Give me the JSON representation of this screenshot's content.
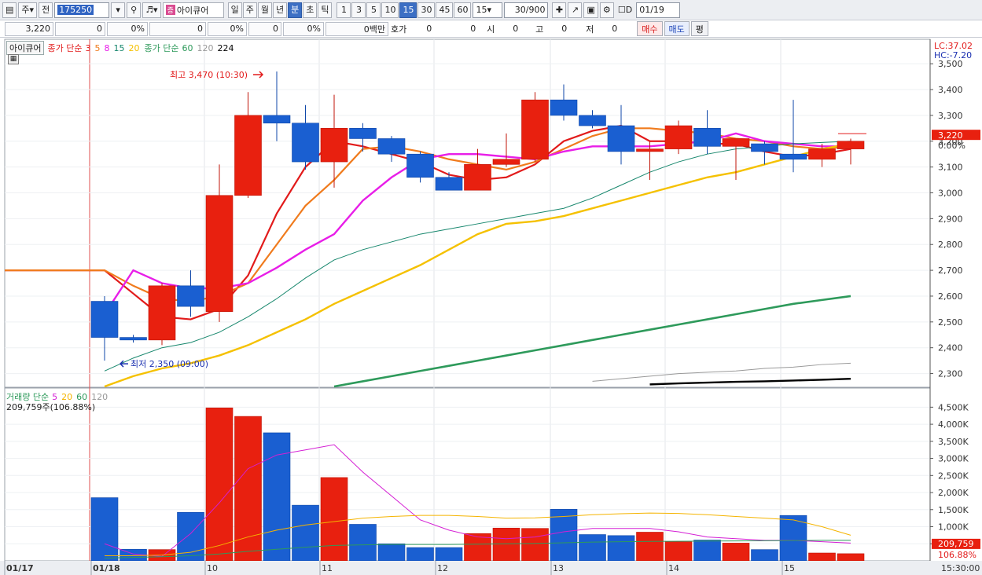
{
  "toolbar": {
    "market_label": "주",
    "prev_label": "전",
    "code": "175250",
    "stock_name": "아이큐어",
    "stock_mark": "증",
    "period_buttons": [
      "일",
      "주",
      "월",
      "년",
      "분",
      "초",
      "틱"
    ],
    "selected_period": "분",
    "interval_buttons": [
      "1",
      "3",
      "5",
      "10",
      "15",
      "30",
      "45",
      "60"
    ],
    "selected_interval": "15",
    "interval_value": "15",
    "count_value": "30/900",
    "date_value": "01/19",
    "checkbox_label": "D"
  },
  "infobar": {
    "price": "3,220",
    "change": "0",
    "rate1": "0%",
    "volume": "0",
    "rate2": "0%",
    "v3": "0",
    "rate3": "0%",
    "mil_label": "0백만",
    "quote_label": "호가",
    "q1": "0",
    "q2": "0",
    "open_label": "시",
    "open_value": "0",
    "high_label": "고",
    "high_value": "0",
    "low_label": "저",
    "low_value": "0",
    "buy_label": "매수",
    "sell_label": "매도",
    "flat_label": "평"
  },
  "price_legend": {
    "name": "아이큐어",
    "ma_label": "종가 단순",
    "ma_periods": [
      "3",
      "5",
      "8",
      "15",
      "20"
    ],
    "ma_colors": [
      "#e21b1b",
      "#f07b1d",
      "#e81ee8",
      "#17876d",
      "#f5c100"
    ],
    "ma2_label": "종가 단순",
    "ma2_periods": [
      "60",
      "120",
      "224"
    ],
    "ma2_colors": [
      "#2e9a5b",
      "#999999",
      "#000000"
    ]
  },
  "volume_legend": {
    "label": "거래량 단순",
    "periods": [
      "5",
      "20",
      "60",
      "120"
    ],
    "period_colors": [
      "#d41fd4",
      "#f5b400",
      "#2e9a5b",
      "#999999"
    ],
    "summary": "209,759주(106.88%)"
  },
  "right_labels": {
    "lc": "LC:37.02",
    "hc": "HC:-7.20",
    "current_price": "3,220",
    "current_rate": "0.00%",
    "current_volume": "209,759",
    "volume_rate": "106.88%",
    "time": "15:30:00"
  },
  "annotations": {
    "high": "최고 3,470 (10:30)",
    "low": "최저 2,350 (09:00)"
  },
  "x_axis_labels": [
    "01/17",
    "01/18",
    "10",
    "11",
    "12",
    "13",
    "14",
    "15"
  ],
  "chart_data": {
    "type": "candlestick",
    "price_axis": {
      "ticks": [
        "3,500",
        "3,400",
        "3,300",
        "3,200",
        "3,100",
        "3,000",
        "2,900",
        "2,800",
        "2,700",
        "2,600",
        "2,500",
        "2,400",
        "2,300"
      ],
      "ylim": [
        2250,
        3540
      ]
    },
    "volume_axis": {
      "ticks": [
        "4,500K",
        "4,000K",
        "3,500K",
        "3,000K",
        "2,500K",
        "2,000K",
        "1,500K",
        "1,000K",
        "500K"
      ],
      "ylim": [
        0,
        4600
      ]
    },
    "candles": [
      {
        "o": 2580,
        "h": 2600,
        "l": 2350,
        "c": 2440,
        "v": 1850
      },
      {
        "o": 2440,
        "h": 2450,
        "l": 2420,
        "c": 2430,
        "v": 340
      },
      {
        "o": 2430,
        "h": 2650,
        "l": 2410,
        "c": 2640,
        "v": 330
      },
      {
        "o": 2640,
        "h": 2700,
        "l": 2520,
        "c": 2560,
        "v": 1420
      },
      {
        "o": 2540,
        "h": 3110,
        "l": 2500,
        "c": 2990,
        "v": 4480
      },
      {
        "o": 2990,
        "h": 3390,
        "l": 2980,
        "c": 3300,
        "v": 4230
      },
      {
        "o": 3300,
        "h": 3470,
        "l": 3200,
        "c": 3270,
        "v": 3750
      },
      {
        "o": 3270,
        "h": 3340,
        "l": 3090,
        "c": 3120,
        "v": 1630
      },
      {
        "o": 3120,
        "h": 3380,
        "l": 3020,
        "c": 3250,
        "v": 2440
      },
      {
        "o": 3250,
        "h": 3270,
        "l": 3160,
        "c": 3210,
        "v": 1070
      },
      {
        "o": 3210,
        "h": 3220,
        "l": 3120,
        "c": 3150,
        "v": 500
      },
      {
        "o": 3150,
        "h": 3160,
        "l": 3040,
        "c": 3060,
        "v": 390
      },
      {
        "o": 3060,
        "h": 3080,
        "l": 3010,
        "c": 3010,
        "v": 390
      },
      {
        "o": 3010,
        "h": 3170,
        "l": 3010,
        "c": 3110,
        "v": 800
      },
      {
        "o": 3110,
        "h": 3230,
        "l": 3100,
        "c": 3130,
        "v": 960
      },
      {
        "o": 3130,
        "h": 3390,
        "l": 3120,
        "c": 3360,
        "v": 950
      },
      {
        "o": 3360,
        "h": 3420,
        "l": 3280,
        "c": 3300,
        "v": 1510
      },
      {
        "o": 3300,
        "h": 3320,
        "l": 3250,
        "c": 3260,
        "v": 770
      },
      {
        "o": 3260,
        "h": 3340,
        "l": 3110,
        "c": 3160,
        "v": 740
      },
      {
        "o": 3160,
        "h": 3200,
        "l": 3050,
        "c": 3170,
        "v": 840
      },
      {
        "o": 3170,
        "h": 3280,
        "l": 3150,
        "c": 3260,
        "v": 560
      },
      {
        "o": 3250,
        "h": 3320,
        "l": 3150,
        "c": 3180,
        "v": 610
      },
      {
        "o": 3180,
        "h": 3190,
        "l": 3050,
        "c": 3210,
        "v": 520
      },
      {
        "o": 3190,
        "h": 3200,
        "l": 3110,
        "c": 3160,
        "v": 330
      },
      {
        "o": 3150,
        "h": 3360,
        "l": 3080,
        "c": 3130,
        "v": 1330
      },
      {
        "o": 3130,
        "h": 3190,
        "l": 3100,
        "c": 3170,
        "v": 230
      },
      {
        "o": 3170,
        "h": 3210,
        "l": 3110,
        "c": 3200,
        "v": 210
      }
    ],
    "moving_averages": [
      {
        "name": "3",
        "color": "#e21b1b",
        "values": [
          2700,
          2610,
          2520,
          2510,
          2550,
          2680,
          2920,
          3100,
          3200,
          3180,
          3150,
          3120,
          3070,
          3050,
          3060,
          3110,
          3200,
          3240,
          3260,
          3200,
          3200,
          3190,
          3190,
          3160,
          3140,
          3150,
          3170
        ]
      },
      {
        "name": "5",
        "color": "#f07b1d",
        "values": [
          2700,
          2640,
          2590,
          2580,
          2600,
          2650,
          2800,
          2950,
          3050,
          3170,
          3180,
          3160,
          3130,
          3110,
          3090,
          3120,
          3170,
          3220,
          3250,
          3250,
          3240,
          3230,
          3210,
          3200,
          3180,
          3170,
          3180
        ]
      },
      {
        "name": "8",
        "color": "#e81ee8",
        "values": [
          2530,
          2700,
          2650,
          2630,
          2630,
          2650,
          2710,
          2780,
          2840,
          2970,
          3060,
          3130,
          3150,
          3150,
          3140,
          3130,
          3160,
          3180,
          3180,
          3180,
          3190,
          3200,
          3230,
          3200,
          3190,
          3180,
          3180
        ]
      },
      {
        "name": "15",
        "color": "#17876d",
        "values": [
          2310,
          2360,
          2400,
          2420,
          2460,
          2520,
          2590,
          2670,
          2740,
          2780,
          2810,
          2840,
          2860,
          2880,
          2900,
          2920,
          2940,
          2980,
          3030,
          3080,
          3120,
          3150,
          3170,
          3180,
          3190,
          3195,
          3200
        ]
      },
      {
        "name": "20",
        "color": "#f5c100",
        "values": [
          2250,
          2290,
          2320,
          2340,
          2370,
          2410,
          2460,
          2510,
          2570,
          2620,
          2670,
          2720,
          2780,
          2840,
          2880,
          2890,
          2910,
          2940,
          2970,
          3000,
          3030,
          3060,
          3080,
          3110,
          3140,
          3170,
          3190
        ]
      },
      {
        "name": "60",
        "color": "#2e9a5b",
        "values": [
          null,
          null,
          null,
          null,
          null,
          null,
          null,
          null,
          2250,
          2270,
          2290,
          2310,
          2330,
          2350,
          2370,
          2390,
          2410,
          2430,
          2450,
          2470,
          2490,
          2510,
          2530,
          2550,
          2570,
          2585,
          2600
        ]
      },
      {
        "name": "120",
        "color": "#999999",
        "values": [
          null,
          null,
          null,
          null,
          null,
          null,
          null,
          null,
          null,
          null,
          null,
          null,
          null,
          null,
          null,
          null,
          null,
          2270,
          2280,
          2290,
          2300,
          2305,
          2310,
          2320,
          2325,
          2335,
          2340
        ]
      },
      {
        "name": "224",
        "color": "#000000",
        "values": [
          null,
          null,
          null,
          null,
          null,
          null,
          null,
          null,
          null,
          null,
          null,
          null,
          null,
          null,
          null,
          null,
          null,
          null,
          null,
          2258,
          2262,
          2265,
          2268,
          2270,
          2273,
          2276,
          2280
        ]
      }
    ],
    "volume_mas": [
      {
        "name": "5",
        "color": "#d41fd4",
        "values": [
          500,
          200,
          130,
          800,
          1700,
          2700,
          3100,
          3250,
          3400,
          2600,
          1900,
          1200,
          900,
          700,
          650,
          700,
          850,
          950,
          950,
          950,
          850,
          700,
          650,
          600,
          600,
          560,
          520
        ]
      },
      {
        "name": "20",
        "color": "#f5b400",
        "values": [
          150,
          150,
          170,
          250,
          450,
          700,
          900,
          1050,
          1150,
          1250,
          1300,
          1330,
          1330,
          1300,
          1250,
          1260,
          1300,
          1350,
          1380,
          1400,
          1390,
          1350,
          1300,
          1250,
          1200,
          1000,
          750
        ]
      },
      {
        "name": "60",
        "color": "#2e9a5b",
        "values": [
          80,
          100,
          120,
          150,
          200,
          280,
          340,
          400,
          450,
          470,
          480,
          480,
          480,
          490,
          500,
          510,
          530,
          550,
          560,
          570,
          575,
          580,
          585,
          590,
          595,
          600,
          600
        ]
      }
    ]
  }
}
